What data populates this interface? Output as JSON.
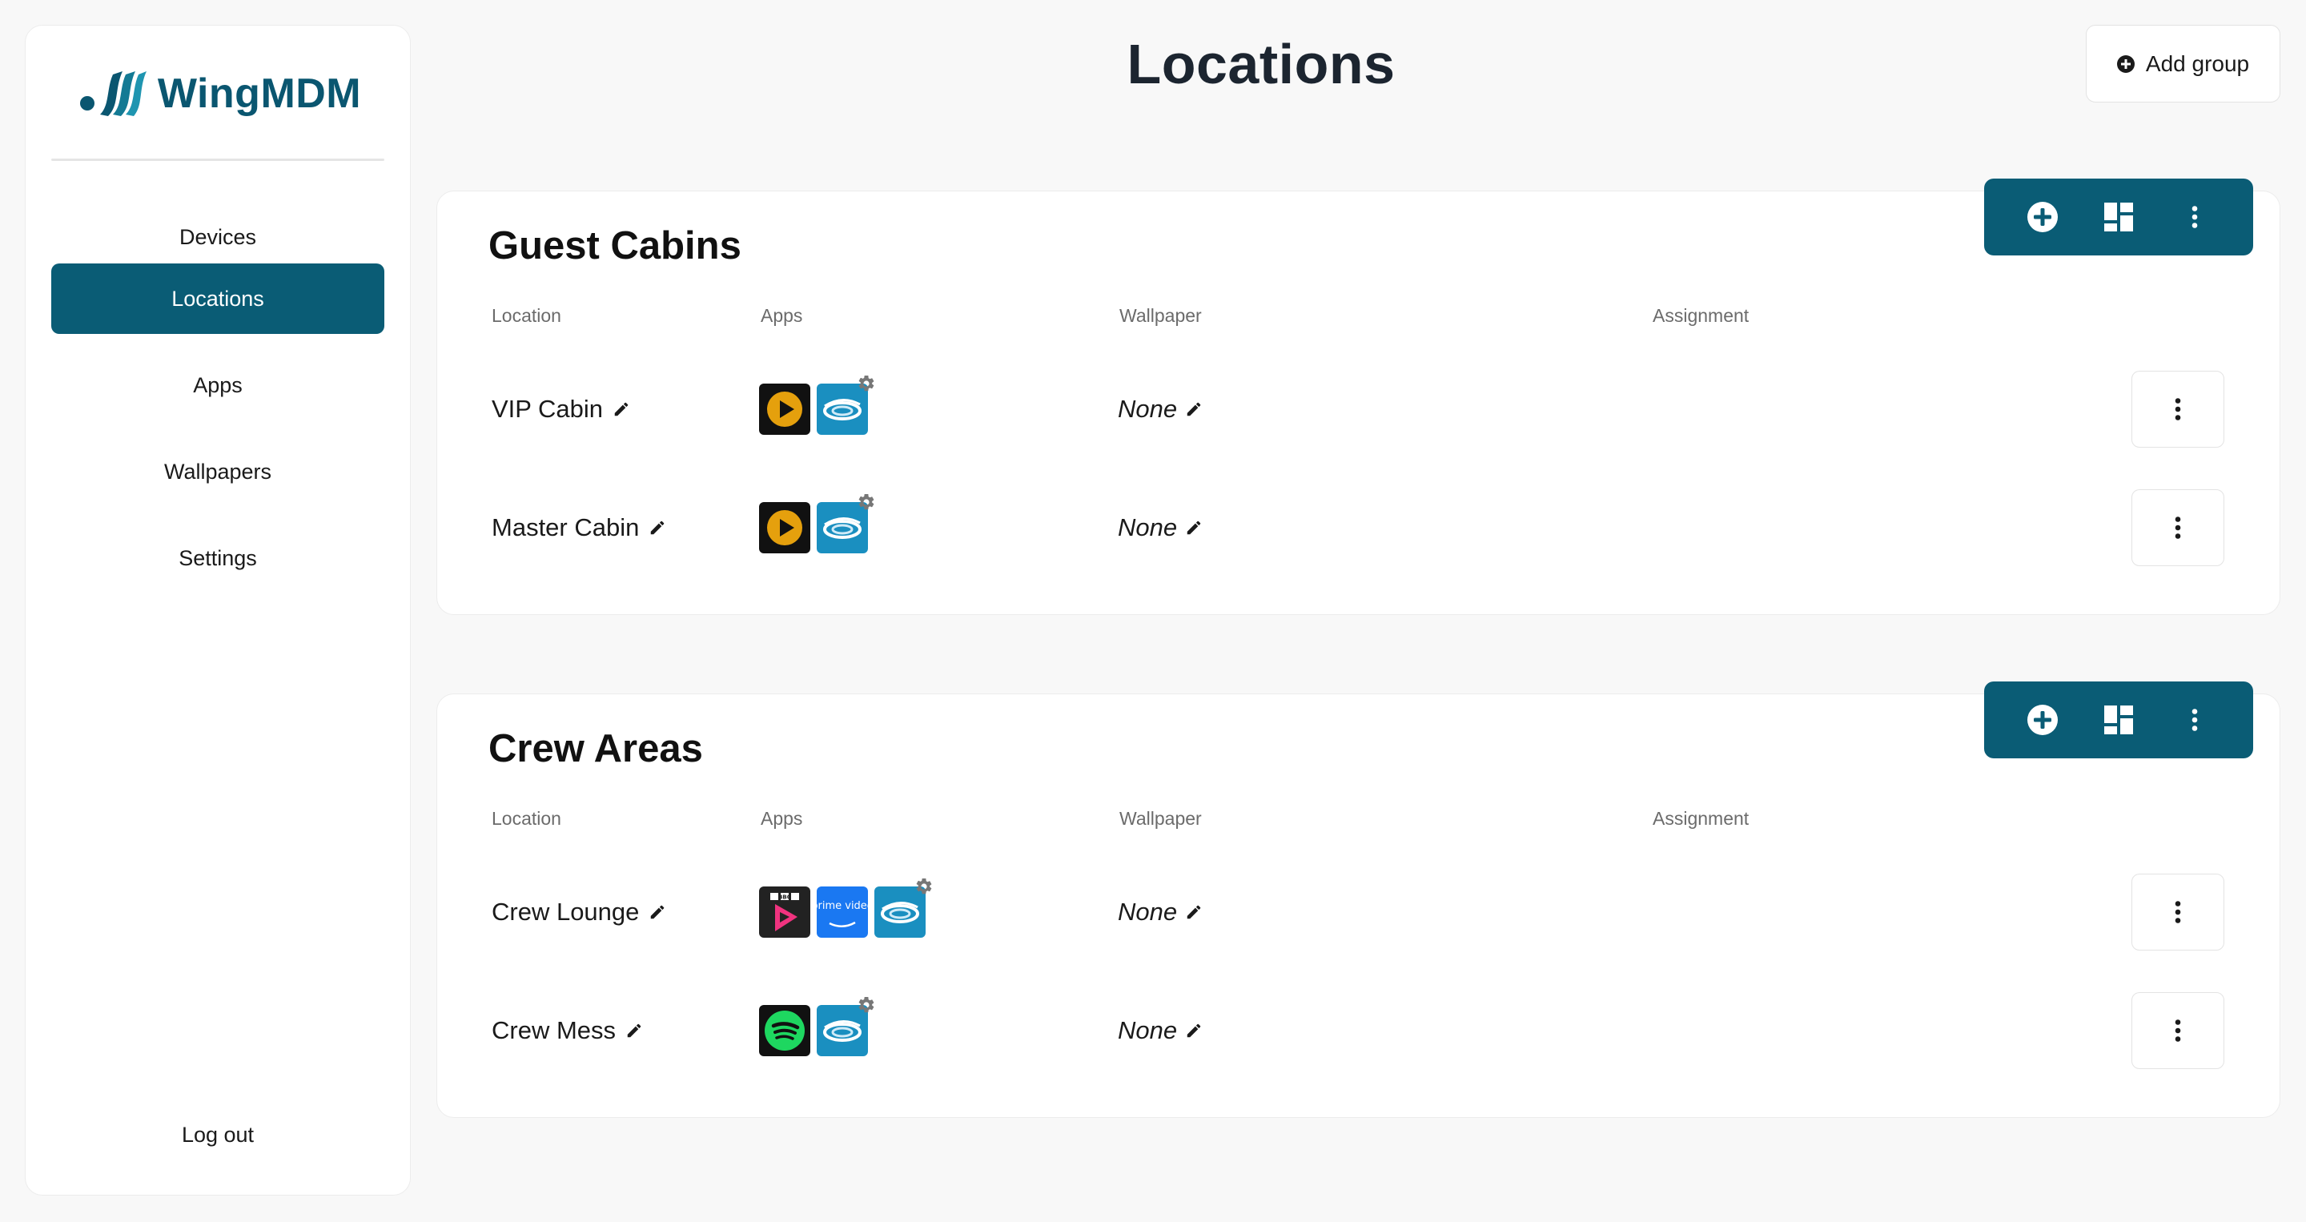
{
  "brand": {
    "name": "WingMDM",
    "color": "#0a5670"
  },
  "sidebar": {
    "items": [
      {
        "label": "Devices",
        "active": false
      },
      {
        "label": "Locations",
        "active": true
      },
      {
        "label": "Apps",
        "active": false
      },
      {
        "label": "Wallpapers",
        "active": false
      },
      {
        "label": "Settings",
        "active": false
      }
    ],
    "logout_label": "Log out"
  },
  "header": {
    "title": "Locations",
    "add_group_label": "Add group"
  },
  "columns": {
    "location": "Location",
    "apps": "Apps",
    "wallpaper": "Wallpaper",
    "assignment": "Assignment"
  },
  "groups": [
    {
      "title": "Guest Cabins",
      "rows": [
        {
          "name": "VIP Cabin",
          "apps": [
            "plex-icon",
            "wing-app-icon"
          ],
          "wallpaper": "None"
        },
        {
          "name": "Master Cabin",
          "apps": [
            "plex-icon",
            "wing-app-icon"
          ],
          "wallpaper": "None"
        }
      ]
    },
    {
      "title": "Crew Areas",
      "rows": [
        {
          "name": "Crew Lounge",
          "apps": [
            "bbc-iplayer-icon",
            "prime-video-icon",
            "wing-app-icon"
          ],
          "wallpaper": "None"
        },
        {
          "name": "Crew Mess",
          "apps": [
            "spotify-icon",
            "wing-app-icon"
          ],
          "wallpaper": "None"
        }
      ]
    }
  ],
  "app_labels": {
    "bbc": "BBC",
    "prime": "prime video"
  },
  "colors": {
    "accent": "#0a5c75",
    "background": "#f8f8f8"
  }
}
